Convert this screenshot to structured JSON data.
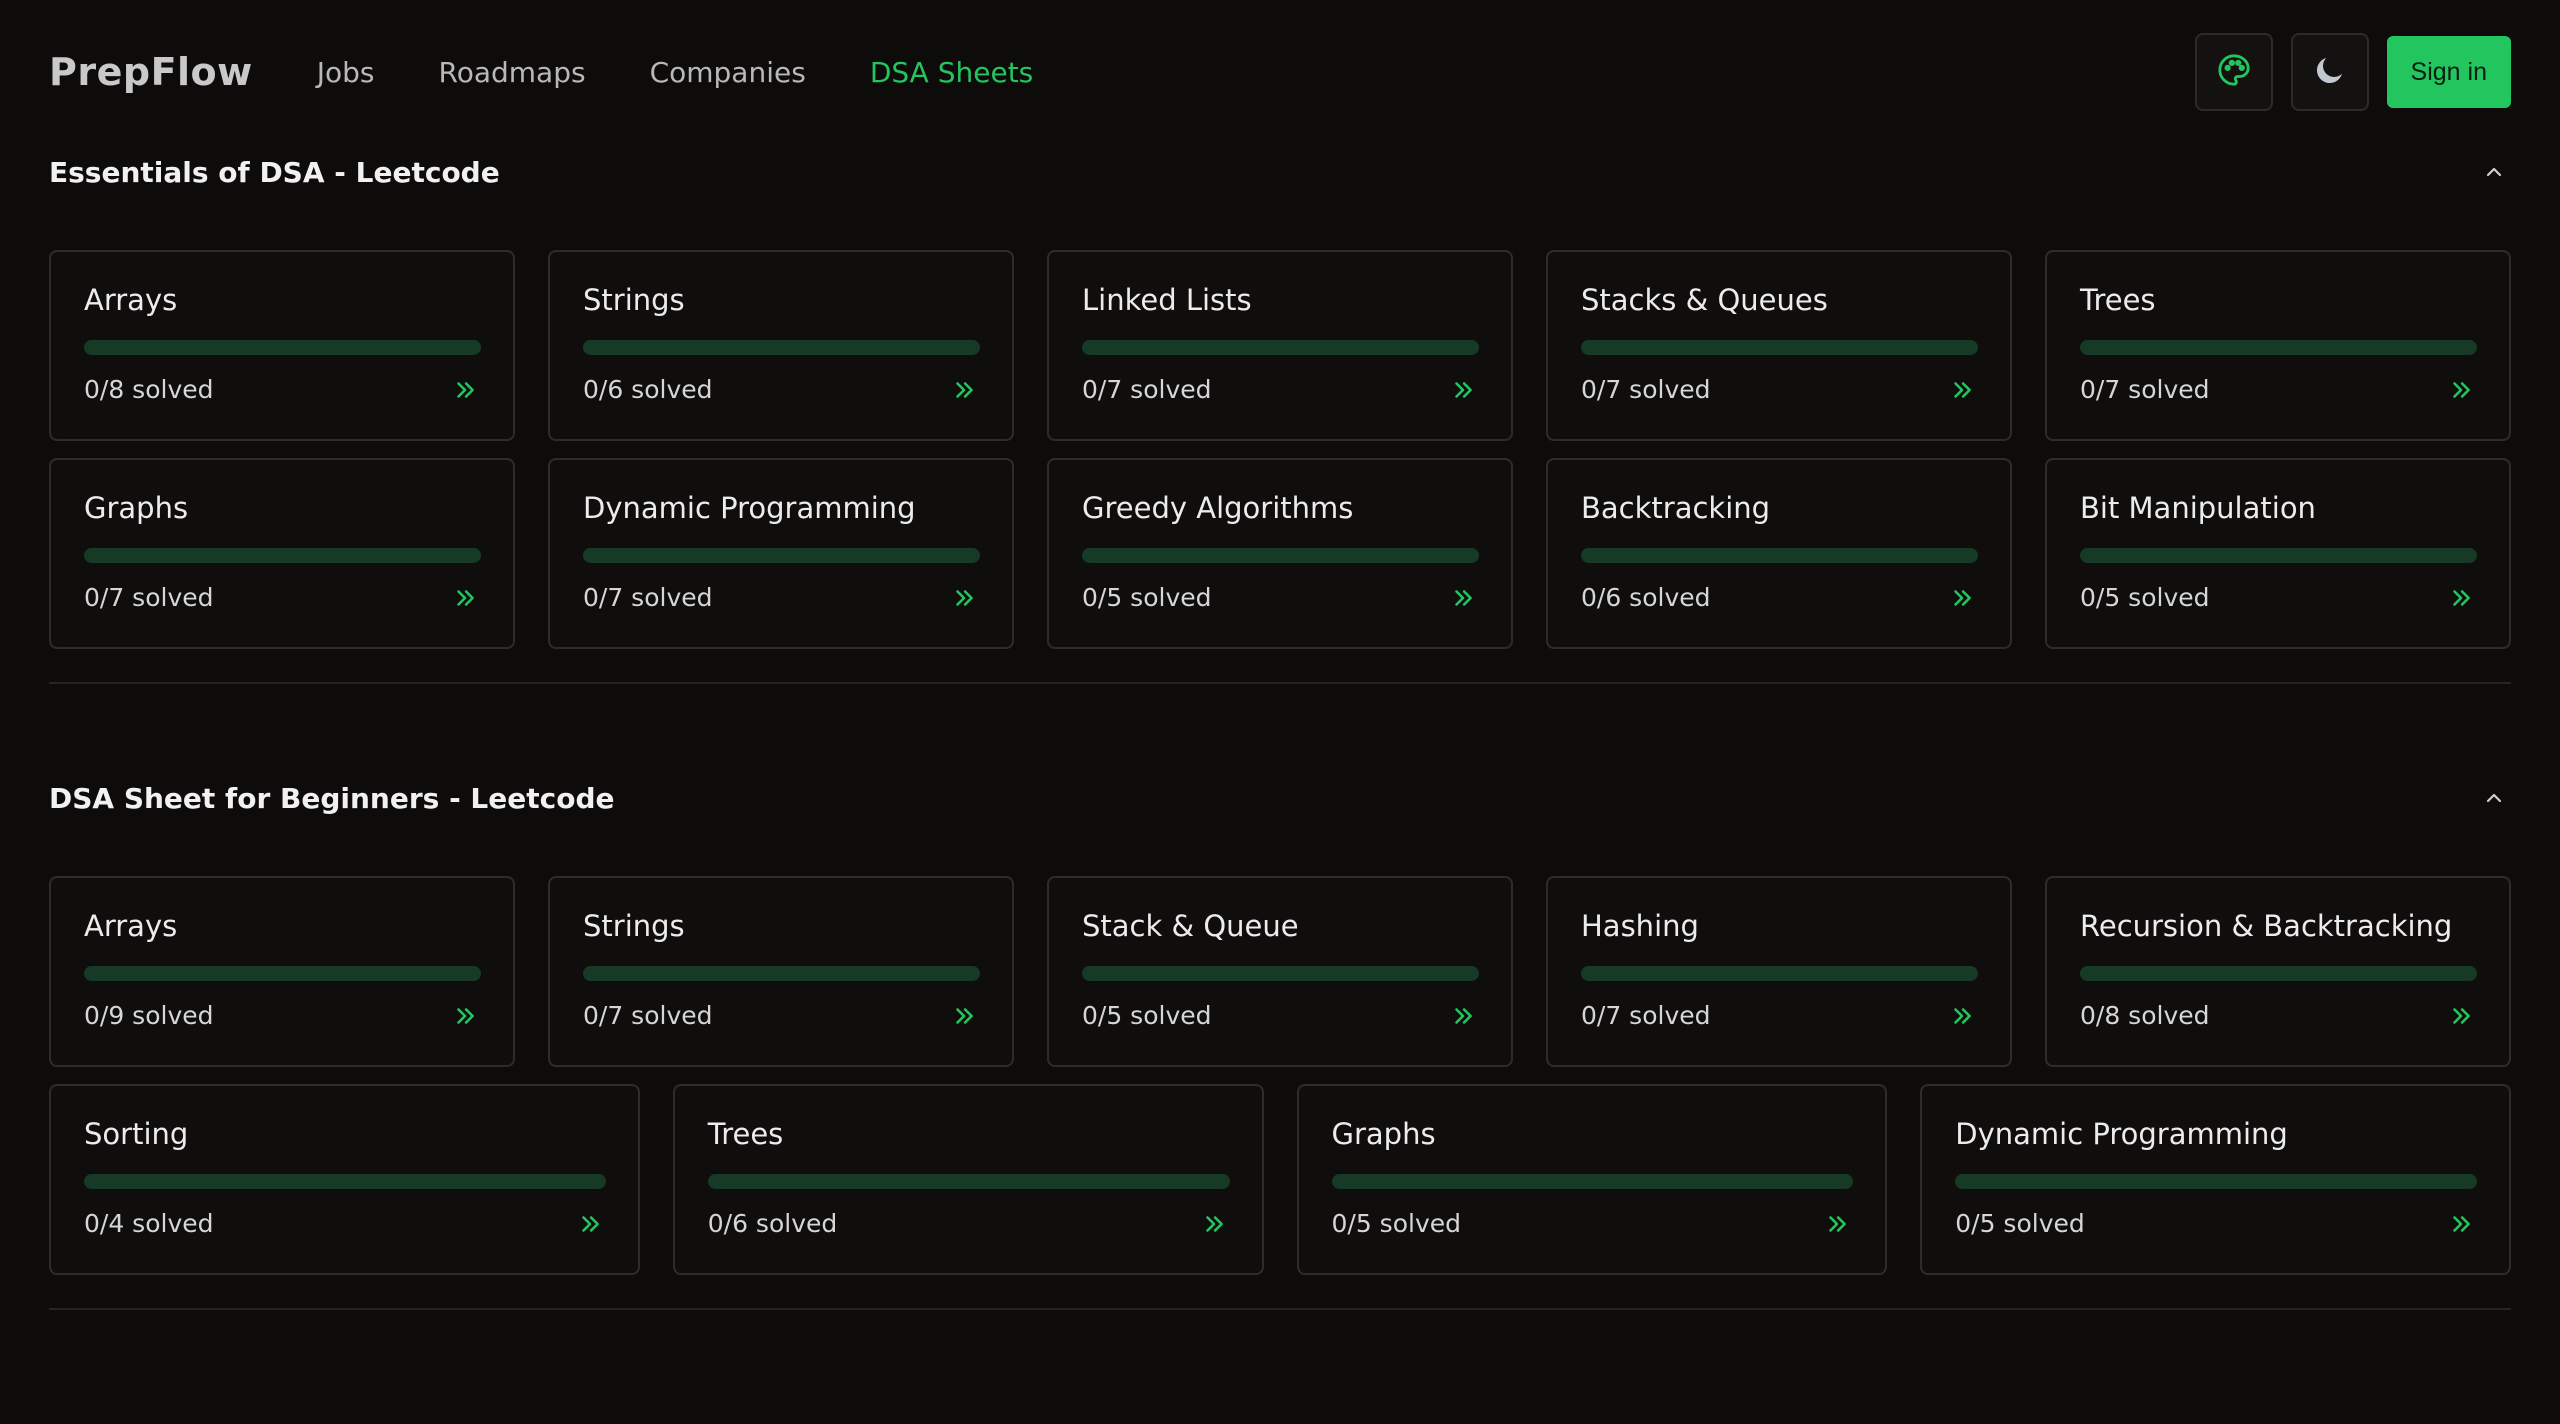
{
  "header": {
    "logo": "PrepFlow",
    "nav": [
      {
        "label": "Jobs",
        "active": false
      },
      {
        "label": "Roadmaps",
        "active": false
      },
      {
        "label": "Companies",
        "active": false
      },
      {
        "label": "DSA Sheets",
        "active": true
      }
    ],
    "palette_icon": "palette-icon",
    "theme_icon": "moon-icon",
    "signin_label": "Sign in"
  },
  "colors": {
    "accent": "#22c55e",
    "background": "#0e0b0b",
    "card_border": "#2f2b2b",
    "progress_track": "#173a26"
  },
  "sections": [
    {
      "title": "Essentials of DSA - Leetcode",
      "cards": [
        {
          "title": "Arrays",
          "solved": "0/8 solved",
          "progress": 0
        },
        {
          "title": "Strings",
          "solved": "0/6 solved",
          "progress": 0
        },
        {
          "title": "Linked Lists",
          "solved": "0/7 solved",
          "progress": 0
        },
        {
          "title": "Stacks & Queues",
          "solved": "0/7 solved",
          "progress": 0
        },
        {
          "title": "Trees",
          "solved": "0/7 solved",
          "progress": 0
        },
        {
          "title": "Graphs",
          "solved": "0/7 solved",
          "progress": 0
        },
        {
          "title": "Dynamic Programming",
          "solved": "0/7 solved",
          "progress": 0
        },
        {
          "title": "Greedy Algorithms",
          "solved": "0/5 solved",
          "progress": 0
        },
        {
          "title": "Backtracking",
          "solved": "0/6 solved",
          "progress": 0
        },
        {
          "title": "Bit Manipulation",
          "solved": "0/5 solved",
          "progress": 0
        }
      ]
    },
    {
      "title": "DSA Sheet for Beginners - Leetcode",
      "cards": [
        {
          "title": "Arrays",
          "solved": "0/9 solved",
          "progress": 0
        },
        {
          "title": "Strings",
          "solved": "0/7 solved",
          "progress": 0
        },
        {
          "title": "Stack & Queue",
          "solved": "0/5 solved",
          "progress": 0
        },
        {
          "title": "Hashing",
          "solved": "0/7 solved",
          "progress": 0
        },
        {
          "title": "Recursion & Backtracking",
          "solved": "0/8 solved",
          "progress": 0
        },
        {
          "title": "Sorting",
          "solved": "0/4 solved",
          "progress": 0
        },
        {
          "title": "Trees",
          "solved": "0/6 solved",
          "progress": 0
        },
        {
          "title": "Graphs",
          "solved": "0/5 solved",
          "progress": 0
        },
        {
          "title": "Dynamic Programming",
          "solved": "0/5 solved",
          "progress": 0
        }
      ]
    }
  ]
}
